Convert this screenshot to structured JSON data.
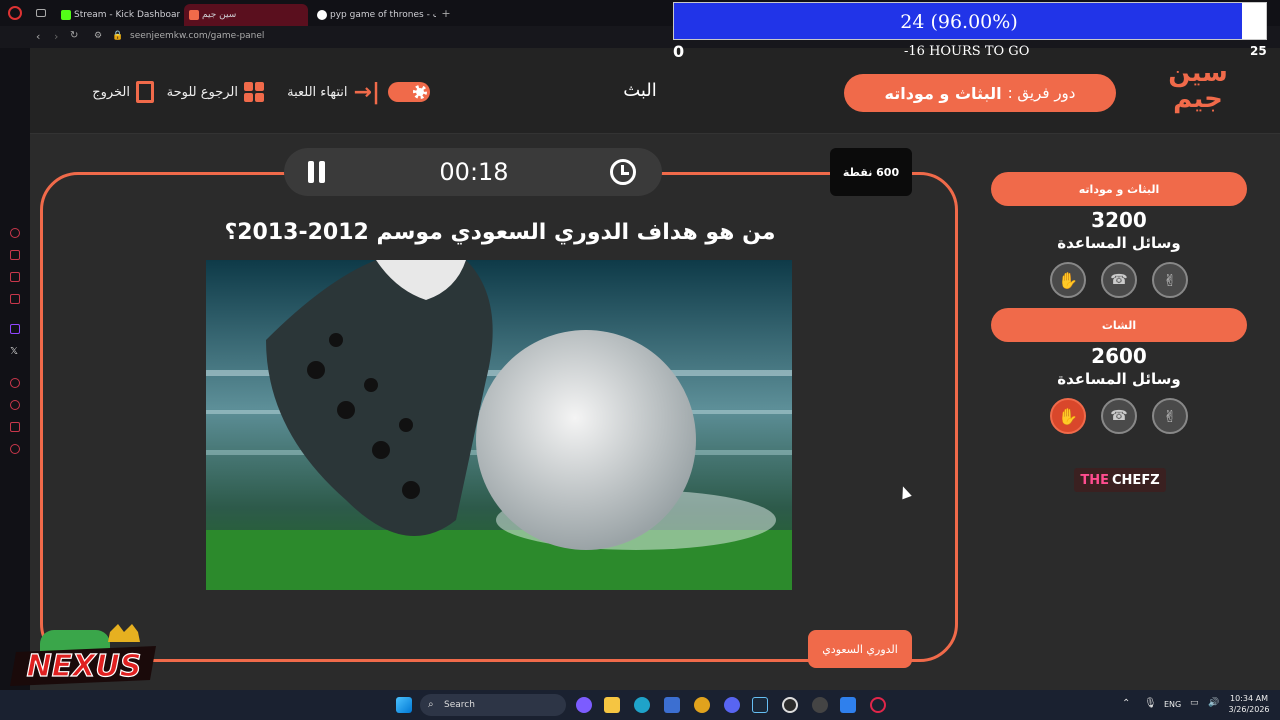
{
  "browser": {
    "tabs": [
      {
        "label": "Stream - Kick Dashboard"
      },
      {
        "label": "سين جيم"
      },
      {
        "label": "pyp game of thrones - بحث"
      }
    ],
    "url": "seenjeemkw.com/game-panel"
  },
  "progress": {
    "text": "24  (96.00%)",
    "fraction": 0.96,
    "left_value": "0",
    "right_value": "25",
    "countdown": "-16 HOURS TO GO"
  },
  "header": {
    "logo_text": "سين جيم",
    "turn_prefix": "دور فريق :",
    "turn_team": "البثاث و موداته",
    "center_title": "البث",
    "end_game_label": "انتهاء اللعبة",
    "back_label": "الرجوع للوحة",
    "exit_label": "الخروج"
  },
  "game": {
    "timer": "00:18",
    "points": "600 نقطة",
    "question": "من هو هداف الدوري السعودي موسم 2012-2013؟",
    "category": "الدوري السعودي"
  },
  "teams": [
    {
      "name": "البثاث و موداته",
      "score": "3200",
      "aids_label": "وسائل المساعدة",
      "active_aid": null
    },
    {
      "name": "الشات",
      "score": "2600",
      "aids_label": "وسائل المساعدة",
      "active_aid": "hand"
    }
  ],
  "sponsor": {
    "the": "THE",
    "chefz": "CHEFZ"
  },
  "overlay_brand": "NEXUS",
  "taskbar": {
    "search_placeholder": "Search",
    "language": "ENG",
    "time": "10:34 AM",
    "date": "3/26/2026"
  },
  "colors": {
    "accent": "#f06a4a",
    "progress_blue": "#2134e8",
    "panel_bg": "#2b2b2b"
  }
}
